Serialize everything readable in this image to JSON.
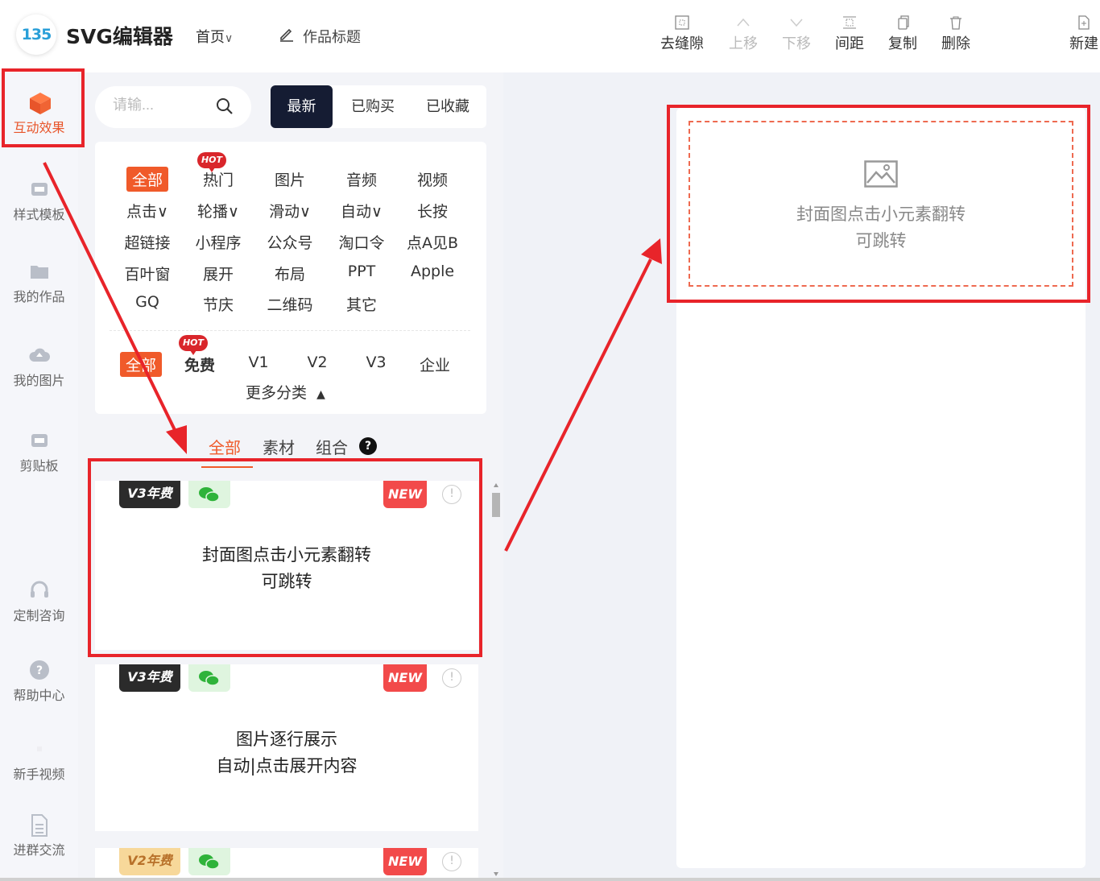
{
  "header": {
    "logo_text": "135",
    "app_title": "SVG编辑器",
    "home_menu": "首页",
    "work_title": "作品标题",
    "toolbar": [
      {
        "label": "去缝隙",
        "icon": "gap-remove-icon",
        "enabled": true
      },
      {
        "label": "上移",
        "icon": "chevron-up-icon",
        "enabled": false
      },
      {
        "label": "下移",
        "icon": "chevron-down-icon",
        "enabled": false
      },
      {
        "label": "间距",
        "icon": "spacing-icon",
        "enabled": true
      },
      {
        "label": "复制",
        "icon": "copy-icon",
        "enabled": true
      },
      {
        "label": "删除",
        "icon": "trash-icon",
        "enabled": true
      },
      {
        "label": "新建",
        "icon": "new-file-icon",
        "enabled": true
      }
    ]
  },
  "sidebar": {
    "items": [
      {
        "label": "互动效果",
        "icon": "cube-icon",
        "active": true
      },
      {
        "label": "样式模板",
        "icon": "template-icon"
      },
      {
        "label": "我的作品",
        "icon": "folder-icon"
      },
      {
        "label": "我的图片",
        "icon": "cloud-icon"
      },
      {
        "label": "剪贴板",
        "icon": "clipboard-icon"
      },
      {
        "label": "定制咨询",
        "icon": "headset-icon"
      },
      {
        "label": "帮助中心",
        "icon": "help-icon"
      },
      {
        "label": "新手视频",
        "icon": "video-icon"
      },
      {
        "label": "进群交流",
        "icon": "document-icon"
      }
    ]
  },
  "panel": {
    "search_placeholder": "请输...",
    "top_tabs": [
      "最新",
      "已购买",
      "已收藏"
    ],
    "categories": {
      "row1": [
        "全部",
        "热门",
        "图片",
        "音频",
        "视频"
      ],
      "row2": [
        "点击∨",
        "轮播∨",
        "滑动∨",
        "自动∨",
        "长按"
      ],
      "row3": [
        "超链接",
        "小程序",
        "公众号",
        "淘口令",
        "点A见B"
      ],
      "row4": [
        "百叶窗",
        "展开",
        "布局",
        "PPT",
        "Apple"
      ],
      "row5": [
        "GQ",
        "节庆",
        "二维码",
        "其它"
      ],
      "hot_label": "HOT"
    },
    "price_filters": [
      "全部",
      "免费",
      "V1",
      "V2",
      "V3",
      "企业"
    ],
    "more_categories": "更多分类",
    "sub_tabs": [
      "全部",
      "素材",
      "组合"
    ],
    "help_mark": "?",
    "cards": [
      {
        "version_badge": "V3年费",
        "new_badge": "NEW",
        "title_line1": "封面图点击小元素翻转",
        "title_line2": "可跳转"
      },
      {
        "version_badge": "V3年费",
        "new_badge": "NEW",
        "title_line1": "图片逐行展示",
        "title_line2": "自动|点击展开内容"
      },
      {
        "version_badge": "V2年费",
        "new_badge": "NEW",
        "title_line1": "",
        "title_line2": ""
      }
    ]
  },
  "canvas": {
    "item_title_line1": "封面图点击小元素翻转",
    "item_title_line2": "可跳转"
  },
  "colors": {
    "accent": "#f05a2a",
    "highlight_red": "#e8242a",
    "dark_tab": "#151c33"
  }
}
